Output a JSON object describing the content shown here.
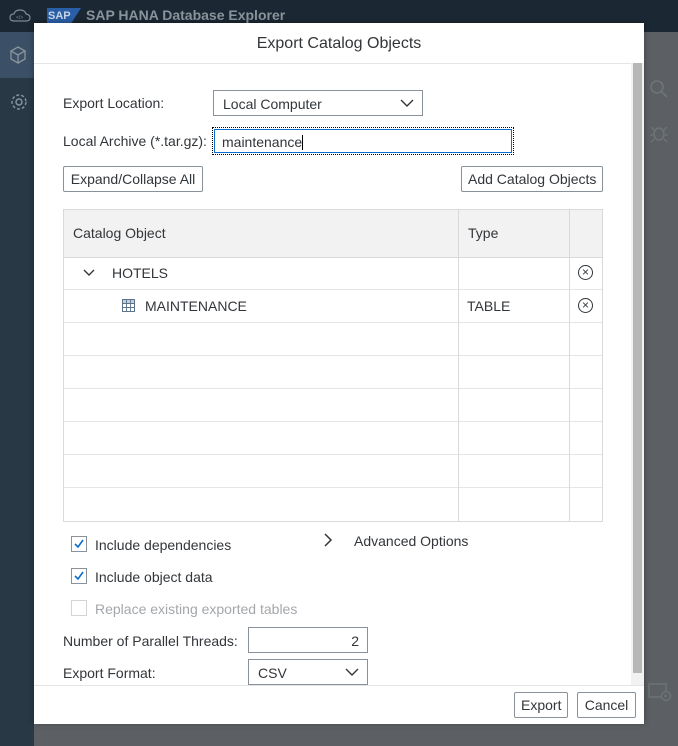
{
  "shell": {
    "app_title": "SAP HANA Database Explorer",
    "logo_text": "SAP",
    "icons": [
      "cloud-icon",
      "catalog-icon",
      "settings-icon",
      "search-icon",
      "debug-icon",
      "console-icon"
    ]
  },
  "dialog": {
    "title": "Export Catalog Objects",
    "export_location": {
      "label": "Export Location:",
      "value": "Local Computer"
    },
    "local_archive": {
      "label": "Local Archive (*.tar.gz):",
      "value": "maintenance"
    },
    "expand_collapse_label": "Expand/Collapse All",
    "add_catalog_objects_label": "Add Catalog Objects",
    "table": {
      "columns": [
        "Catalog Object",
        "Type"
      ],
      "rows": [
        {
          "name": "HOTELS",
          "type": "",
          "level": 0,
          "expanded": true,
          "icon": "chevron-down-icon"
        },
        {
          "name": "MAINTENANCE",
          "type": "TABLE",
          "level": 1,
          "icon": "table-icon"
        }
      ],
      "empty_rows": 6
    },
    "options": {
      "include_dependencies": {
        "label": "Include dependencies",
        "checked": true
      },
      "include_object_data": {
        "label": "Include object data",
        "checked": true
      },
      "replace_existing": {
        "label": "Replace existing exported tables",
        "checked": false,
        "disabled": true
      },
      "advanced_options_label": "Advanced Options"
    },
    "parallel_threads": {
      "label": "Number of Parallel Threads:",
      "value": "2"
    },
    "export_format": {
      "label": "Export Format:",
      "value": "CSV"
    },
    "export_label": "Export",
    "cancel_label": "Cancel"
  },
  "colors": {
    "shellbar": "#1b2733",
    "accent": "#0a6ed1",
    "text": "#32363a",
    "overlay": "#5c6064"
  }
}
